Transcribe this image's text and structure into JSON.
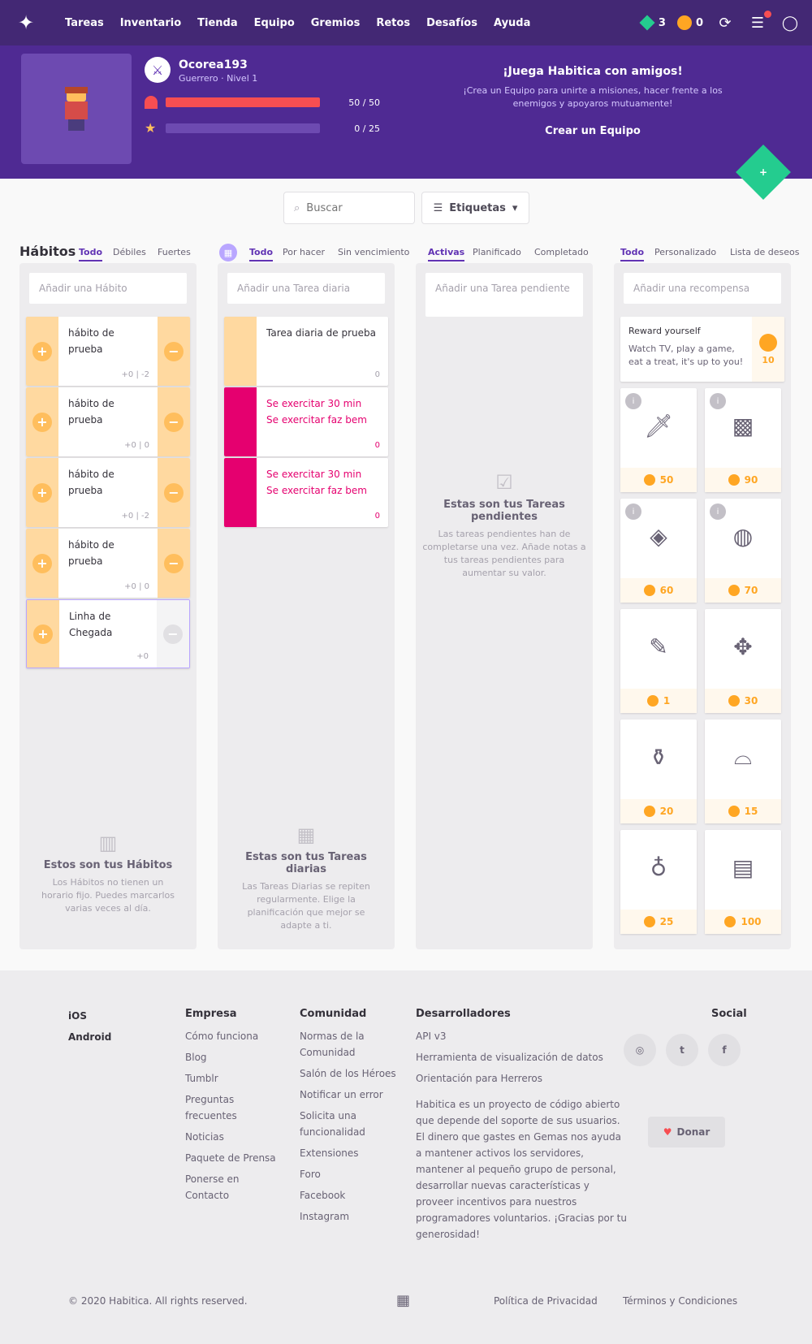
{
  "nav": {
    "items": [
      "Tareas",
      "Inventario",
      "Tienda",
      "Equipo",
      "Gremios",
      "Retos",
      "Desafíos",
      "Ayuda"
    ],
    "gems": "3",
    "gold": "0"
  },
  "header": {
    "username": "Ocorea193",
    "user_class": "Guerrero · Nivel 1",
    "level": "1",
    "hp_value": "50 / 50",
    "xp_value": "0 / 25",
    "hp_pct": 1.0,
    "xp_pct": 0.0,
    "party_title": "¡Juega Habitica con amigos!",
    "party_desc": "¡Crea un Equipo para unirte a misiones, hacer frente a los enemigos y apoyaros mutuamente!",
    "party_button": "Crear un Equipo"
  },
  "toolbar": {
    "search_placeholder": "Buscar",
    "tags_label": "Etiquetas"
  },
  "habits": {
    "title": "Hábitos",
    "filters": [
      "Todo",
      "Débiles",
      "Fuertes"
    ],
    "add": "Añadir una Hábito",
    "items": [
      {
        "text": "hábito de prueba",
        "meta": "+0 | -2"
      },
      {
        "text": "hábito de prueba",
        "meta": "+0 | 0"
      },
      {
        "text": "hábito de prueba",
        "meta": "+0 | -2"
      },
      {
        "text": "hábito de prueba",
        "meta": "+0 | 0"
      },
      {
        "text": "Linha de Chegada",
        "meta": "+0"
      }
    ],
    "empty_title": "Estos son tus Hábitos",
    "empty_desc": "Los Hábitos no tienen un horario fijo. Puedes marcarlos varias veces al día."
  },
  "dailies": {
    "filters": [
      "Todo",
      "Por hacer",
      "Sin vencimiento"
    ],
    "add": "Añadir una Tarea diaria",
    "items": [
      {
        "text": "Tarea diaria de prueba",
        "meta": "0"
      },
      {
        "text": "Se exercitar 30 min\nSe exercitar faz bem",
        "meta": "0"
      },
      {
        "text": "Se exercitar 30 min\nSe exercitar faz bem",
        "meta": "0"
      }
    ],
    "empty_title": "Estas son tus Tareas diarias",
    "empty_desc": "Las Tareas Diarias se repiten regularmente. Elige la planificación que mejor se adapte a ti."
  },
  "todos": {
    "filters": [
      "Activas",
      "Planificado",
      "Completado"
    ],
    "add": "Añadir una Tarea pendiente",
    "empty_title": "Estas son tus Tareas pendientes",
    "empty_desc": "Las tareas pendientes han de completarse una vez. Añade notas a tus tareas pendientes para aumentar su valor."
  },
  "rewards": {
    "filters": [
      "Todo",
      "Personalizado",
      "Lista de deseos"
    ],
    "add": "Añadir una recompensa",
    "custom_title": "Reward yourself",
    "custom_desc": "Watch TV, play a game, eat a treat, it's up to you!",
    "custom_price": "10",
    "items": [
      {
        "price": "50"
      },
      {
        "price": "90"
      },
      {
        "price": "60"
      },
      {
        "price": "70"
      },
      {
        "price": "1"
      },
      {
        "price": "30"
      },
      {
        "price": "20"
      },
      {
        "price": "15"
      },
      {
        "price": "25"
      },
      {
        "price": "100"
      }
    ]
  },
  "footer": {
    "apps": [
      "iOS",
      "Android"
    ],
    "company_title": "Empresa",
    "company": [
      "Cómo funciona",
      "Blog",
      "Tumblr",
      "Preguntas frecuentes",
      "Noticias",
      "Paquete de Prensa",
      "Ponerse en Contacto"
    ],
    "community_title": "Comunidad",
    "community": [
      "Normas de la Comunidad",
      "Salón de los Héroes",
      "Notificar un error",
      "Solicita una funcionalidad",
      "Extensiones",
      "Foro",
      "Facebook",
      "Instagram"
    ],
    "dev_title": "Desarrolladores",
    "dev": [
      "API v3",
      "Herramienta de visualización de datos",
      "Orientación para Herreros"
    ],
    "dev_desc": "Habitica es un proyecto de código abierto que depende del soporte de sus usuarios. El dinero que gastes en Gemas nos ayuda a mantener activos los servidores, mantener al pequeño grupo de personal, desarrollar nuevas características y proveer incentivos para nuestros programadores voluntarios. ¡Gracias por tu generosidad!",
    "social_title": "Social",
    "donate": "Donar",
    "copyright": "© 2020 Habitica. All rights reserved.",
    "privacy": "Política de Privacidad",
    "terms": "Términos y Condiciones"
  }
}
